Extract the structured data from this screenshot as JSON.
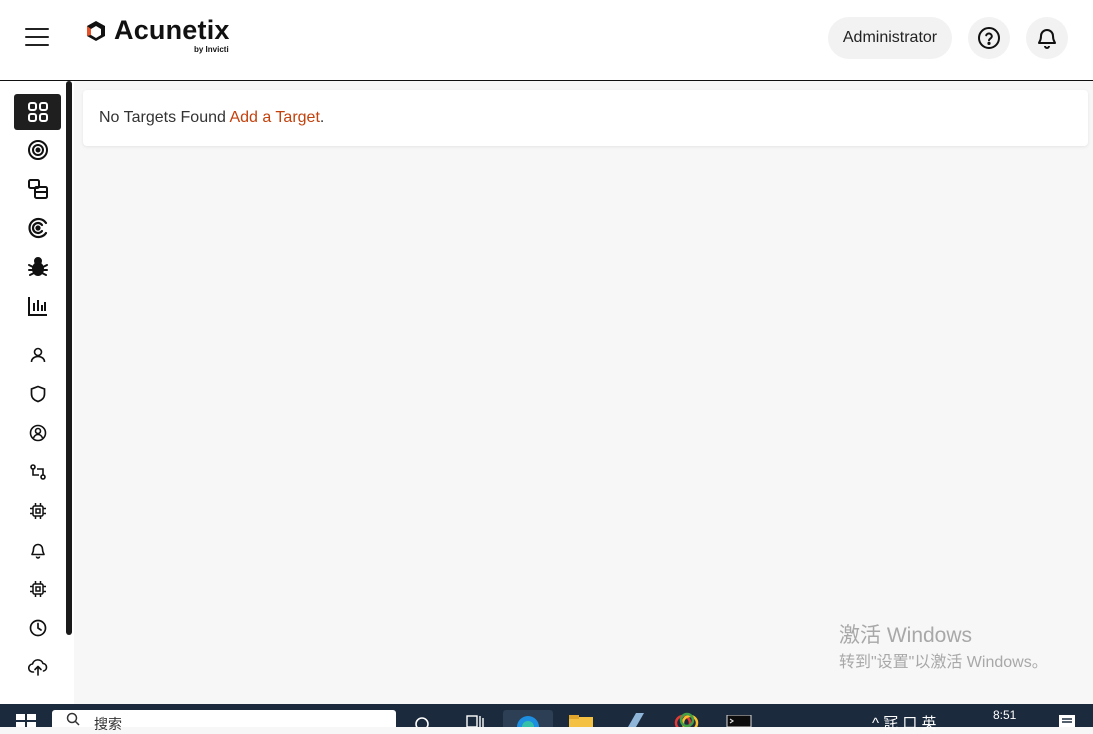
{
  "header": {
    "brand": "Acunetix",
    "brand_sub": "by Invicti",
    "user_label": "Administrator"
  },
  "sidebar": {
    "items": [
      {
        "icon": "dashboard-icon",
        "active": true
      },
      {
        "icon": "targets-icon"
      },
      {
        "icon": "target-groups-icon"
      },
      {
        "icon": "scans-icon"
      },
      {
        "icon": "vulnerabilities-icon"
      },
      {
        "icon": "reports-icon"
      },
      {
        "icon": "users-icon"
      },
      {
        "icon": "scan-profiles-icon"
      },
      {
        "icon": "network-scanner-icon"
      },
      {
        "icon": "issue-trackers-icon"
      },
      {
        "icon": "integrations-icon"
      },
      {
        "icon": "notifications-icon"
      },
      {
        "icon": "engines-icon"
      },
      {
        "icon": "history-icon"
      },
      {
        "icon": "updates-icon"
      }
    ]
  },
  "main": {
    "empty_text": "No Targets Found ",
    "add_link": "Add a Target",
    "add_suffix": "."
  },
  "watermark": {
    "line1": "激活 Windows",
    "line2": "转到\"设置\"以激活 Windows。"
  },
  "taskbar": {
    "search_placeholder": "搜索",
    "tray_text": "^ 㓃 口 英",
    "time": "8:51"
  },
  "colors": {
    "accent_link": "#c2410c",
    "active_nav": "#1f1f1f",
    "taskbar": "#1b2a3d"
  }
}
